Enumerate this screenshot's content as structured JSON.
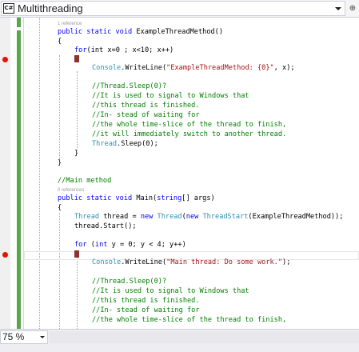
{
  "nav": {
    "file_icon": "C#",
    "member": "Multithreading",
    "pin": "⊕"
  },
  "code": {
    "lens1": "1 reference",
    "l1": [
      "public",
      "static",
      "void",
      "ExampleThreadMethod()"
    ],
    "l2": "{",
    "l3": [
      "for",
      "(int x=0 ; x<10; x++)"
    ],
    "l4": "{",
    "l5": [
      "Console",
      ".WriteLine(",
      "\"ExampleThreadMethod: {0}\"",
      ", x);"
    ],
    "c1": "//Thread.Sleep(0)?",
    "c2": "//It is used to signal to Windows that",
    "c3": "//this thread is finished.",
    "c4": "//In- stead of waiting for",
    "c5": "//the whole time-slice of the thread to finish,",
    "c6": "//it will immediately switch to another thread.",
    "l6": [
      "Thread",
      ".Sleep(0);"
    ],
    "l7": "}",
    "l8": "}",
    "cmain": "//Main method",
    "lens2": "0 references",
    "m1": [
      "public",
      "static",
      "void",
      "Main(",
      "string",
      "[] args)"
    ],
    "m2": "{",
    "m3": [
      "Thread",
      "thread =",
      "new",
      "Thread",
      "(",
      "new",
      "ThreadStart",
      "(ExampleThreadMethod));"
    ],
    "m4": "thread.Start();",
    "m5": [
      "for",
      "(",
      "int",
      "y = 0; y < 4; y++)"
    ],
    "m6": "{",
    "m7": [
      "Console",
      ".WriteLine(",
      "\"Main thread: Do some work.\"",
      ");"
    ],
    "d1": "//Thread.Sleep(0)?",
    "d2": "//It is used to signal to Windows that",
    "d3": "//this thread is finished.",
    "d4": "//In- stead of waiting for",
    "d5": "//the whole time-slice of the thread to finish,"
  },
  "status": {
    "zoom": "75 %"
  },
  "colors": {
    "keyword": "#0000ff",
    "type": "#2b91af",
    "string": "#a31515",
    "comment": "#008000",
    "breakpoint": "#e51400"
  }
}
